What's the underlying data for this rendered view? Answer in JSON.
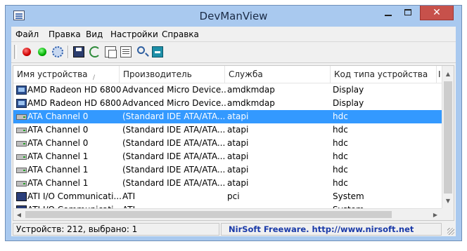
{
  "window": {
    "title": "DevManView"
  },
  "titlebar_buttons": {
    "close_glyph": "✕"
  },
  "menu": [
    "Файл",
    "Правка",
    "Вид",
    "Настройки",
    "Справка"
  ],
  "toolbar": {
    "icons": [
      "disable-red-icon",
      "enable-green-icon",
      "device-properties-gear-icon",
      "save-icon",
      "refresh-icon",
      "copy-icon",
      "html-report-icon",
      "find-icon",
      "exit-icon"
    ]
  },
  "columns": [
    "Имя устройства",
    "Производитель",
    "Служба",
    "Код типа устройства",
    "I"
  ],
  "sort_indicator": "/",
  "rows": [
    {
      "icon": "monitor-icon",
      "name": "AMD Radeon HD 6800...",
      "manufacturer": "Advanced Micro Device...",
      "service": "amdkmdap",
      "type": "Display",
      "selected": false
    },
    {
      "icon": "monitor-icon",
      "name": "AMD Radeon HD 6800...",
      "manufacturer": "Advanced Micro Device...",
      "service": "amdkmdap",
      "type": "Display",
      "selected": false
    },
    {
      "icon": "drive-icon",
      "name": "ATA Channel 0",
      "manufacturer": "(Standard IDE ATA/ATA...",
      "service": "atapi",
      "type": "hdc",
      "selected": true
    },
    {
      "icon": "drive-icon",
      "name": "ATA Channel 0",
      "manufacturer": "(Standard IDE ATA/ATA...",
      "service": "atapi",
      "type": "hdc",
      "selected": false
    },
    {
      "icon": "drive-icon",
      "name": "ATA Channel 0",
      "manufacturer": "(Standard IDE ATA/ATA...",
      "service": "atapi",
      "type": "hdc",
      "selected": false
    },
    {
      "icon": "drive-icon",
      "name": "ATA Channel 1",
      "manufacturer": "(Standard IDE ATA/ATA...",
      "service": "atapi",
      "type": "hdc",
      "selected": false
    },
    {
      "icon": "drive-icon",
      "name": "ATA Channel 1",
      "manufacturer": "(Standard IDE ATA/ATA...",
      "service": "atapi",
      "type": "hdc",
      "selected": false
    },
    {
      "icon": "drive-icon",
      "name": "ATA Channel 1",
      "manufacturer": "(Standard IDE ATA/ATA...",
      "service": "atapi",
      "type": "hdc",
      "selected": false
    },
    {
      "icon": "chip-icon",
      "name": "ATI I/O Communicati...",
      "manufacturer": "ATI",
      "service": "pci",
      "type": "System",
      "selected": false
    },
    {
      "icon": "chip-icon",
      "name": "ATI I/O Communicati...",
      "manufacturer": "ATI",
      "service": "",
      "type": "System",
      "selected": false
    }
  ],
  "status": {
    "left": "Устройств: 212, выбрано: 1",
    "right": "NirSoft Freeware.  http://www.nirsoft.net"
  },
  "colors": {
    "selection": "#3399ff",
    "link": "#1a3aa8",
    "titlebar": "#a9c9ef",
    "close_button": "#c7514b"
  }
}
